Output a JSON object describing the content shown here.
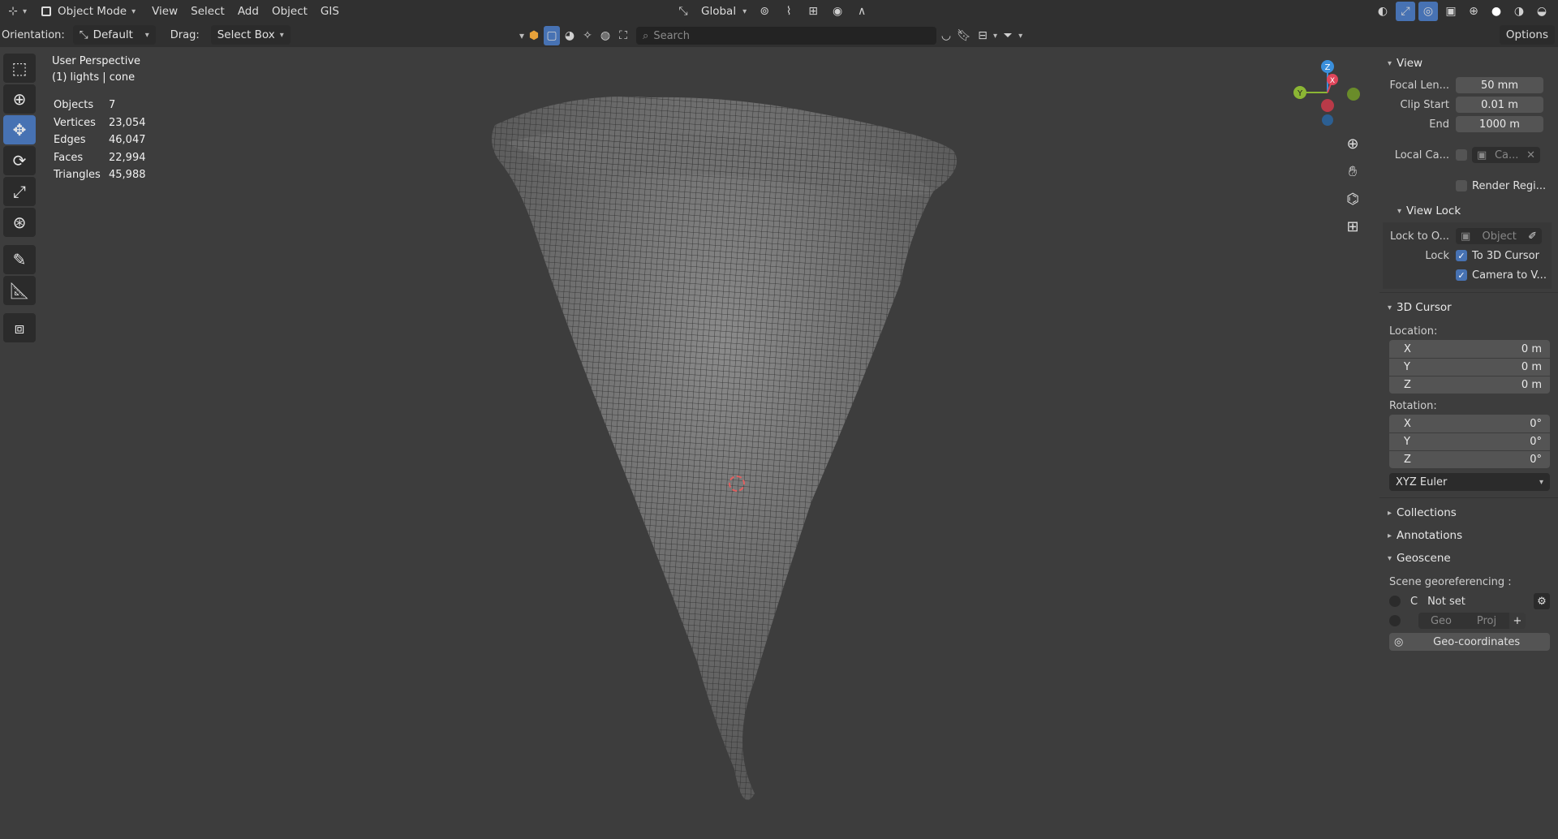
{
  "header": {
    "mode": "Object Mode",
    "menus": [
      "View",
      "Select",
      "Add",
      "Object",
      "GIS"
    ],
    "transform_orientation": "Global",
    "right_options": "Options"
  },
  "subheader": {
    "orientation_label": "Orientation:",
    "orientation_value": "Default",
    "drag_label": "Drag:",
    "drag_value": "Select Box",
    "search_placeholder": "Search"
  },
  "viewport": {
    "view_name": "User Perspective",
    "collection_object": "(1) lights | cone",
    "stats": [
      {
        "label": "Objects",
        "value": "7"
      },
      {
        "label": "Vertices",
        "value": "23,054"
      },
      {
        "label": "Edges",
        "value": "46,047"
      },
      {
        "label": "Faces",
        "value": "22,994"
      },
      {
        "label": "Triangles",
        "value": "45,988"
      }
    ],
    "gizmo": {
      "z": "Z",
      "y": "Y",
      "x": "X"
    }
  },
  "sidebar": {
    "view": {
      "title": "View",
      "focal_label": "Focal Len...",
      "focal_value": "50 mm",
      "clip_start_label": "Clip Start",
      "clip_start_value": "0.01 m",
      "end_label": "End",
      "end_value": "1000 m",
      "local_camera_label": "Local Ca...",
      "local_camera_value": "Ca...",
      "render_region_label": "Render Regi..."
    },
    "view_lock": {
      "title": "View Lock",
      "lock_to_label": "Lock to O...",
      "lock_to_value": "Object",
      "lock_label": "Lock",
      "to_3d_cursor": "To 3D Cursor",
      "camera_to_view": "Camera to V..."
    },
    "cursor": {
      "title": "3D Cursor",
      "location_label": "Location:",
      "location": [
        {
          "axis": "X",
          "value": "0 m"
        },
        {
          "axis": "Y",
          "value": "0 m"
        },
        {
          "axis": "Z",
          "value": "0 m"
        }
      ],
      "rotation_label": "Rotation:",
      "rotation": [
        {
          "axis": "X",
          "value": "0°"
        },
        {
          "axis": "Y",
          "value": "0°"
        },
        {
          "axis": "Z",
          "value": "0°"
        }
      ],
      "rotation_mode": "XYZ Euler"
    },
    "collections": "Collections",
    "annotations": "Annotations",
    "geoscene": {
      "title": "Geoscene",
      "georef_label": "Scene georeferencing :",
      "crs_letter": "C",
      "status": "Not set",
      "geo_btn": "Geo",
      "proj_btn": "Proj",
      "geo_coords": "Geo-coordinates"
    }
  },
  "colors": {
    "accent": "#4772b3",
    "panel_bg": "#3d3d3d",
    "header_bg": "#303030",
    "axis_x": "#e0455a",
    "axis_y": "#8bb634",
    "axis_z": "#3a8fdb"
  }
}
